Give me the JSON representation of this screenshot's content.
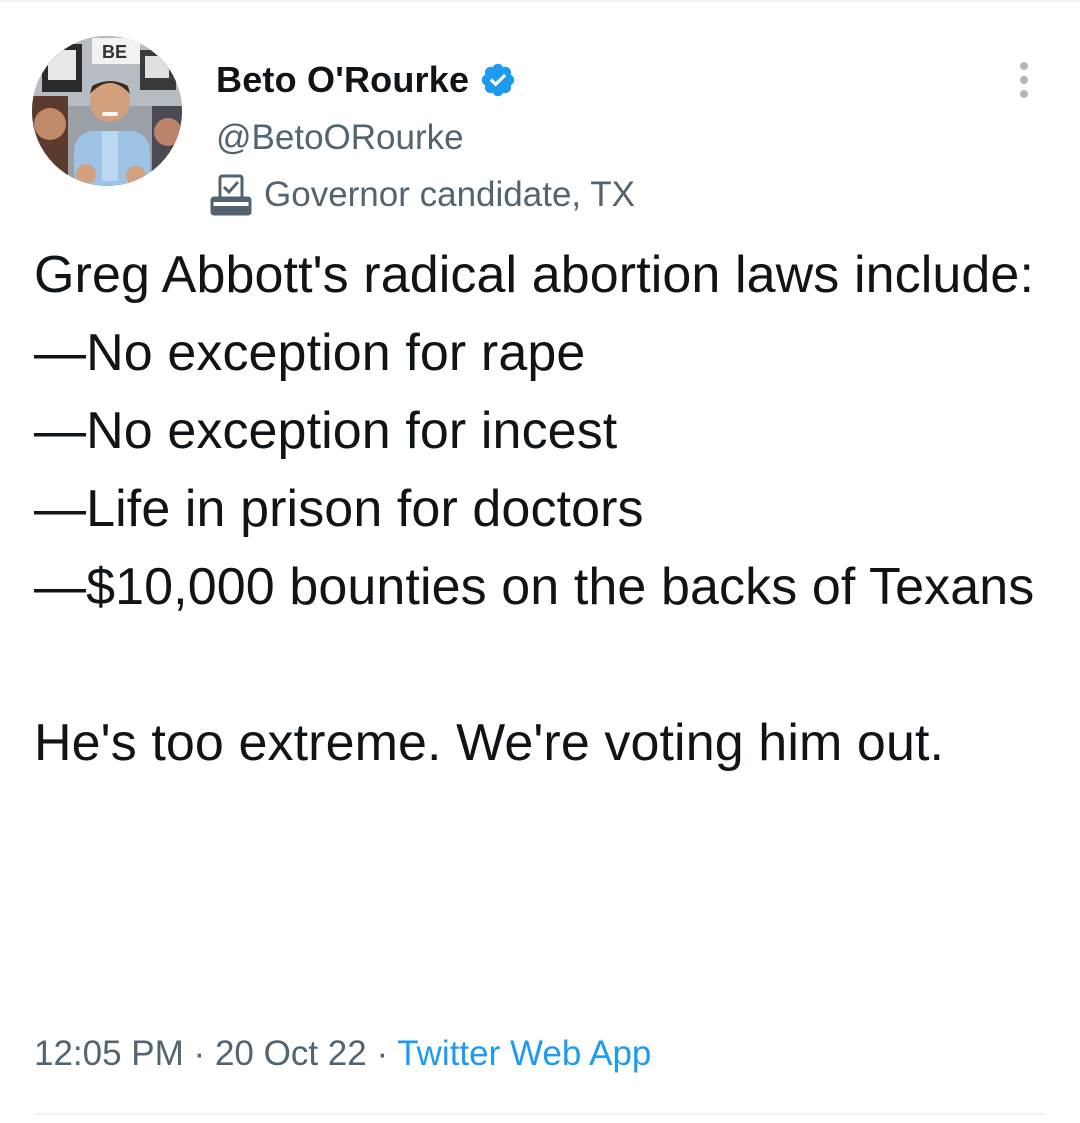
{
  "tweet": {
    "author": {
      "display_name": "Beto O'Rourke",
      "handle": "@BetoORourke",
      "verified": true,
      "label": "Governor candidate, TX",
      "label_icon": "ballot-box-icon",
      "avatar_sign_text": "BE"
    },
    "text": "Greg Abbott's radical abortion laws include:\n—No exception for rape\n—No exception for incest\n—Life in prison for doctors\n—$10,000 bounties on the backs of Texans\n\nHe's too extreme. We're voting him out.",
    "time": "12:05 PM",
    "separator": "·",
    "date": "20 Oct 22",
    "source": "Twitter Web App"
  },
  "colors": {
    "text": "#0f1419",
    "secondary": "#536471",
    "accent": "#1d9bf0",
    "divider": "#eff3f4"
  },
  "icons": {
    "verified": "verified-badge-icon",
    "more": "more-options-icon"
  }
}
